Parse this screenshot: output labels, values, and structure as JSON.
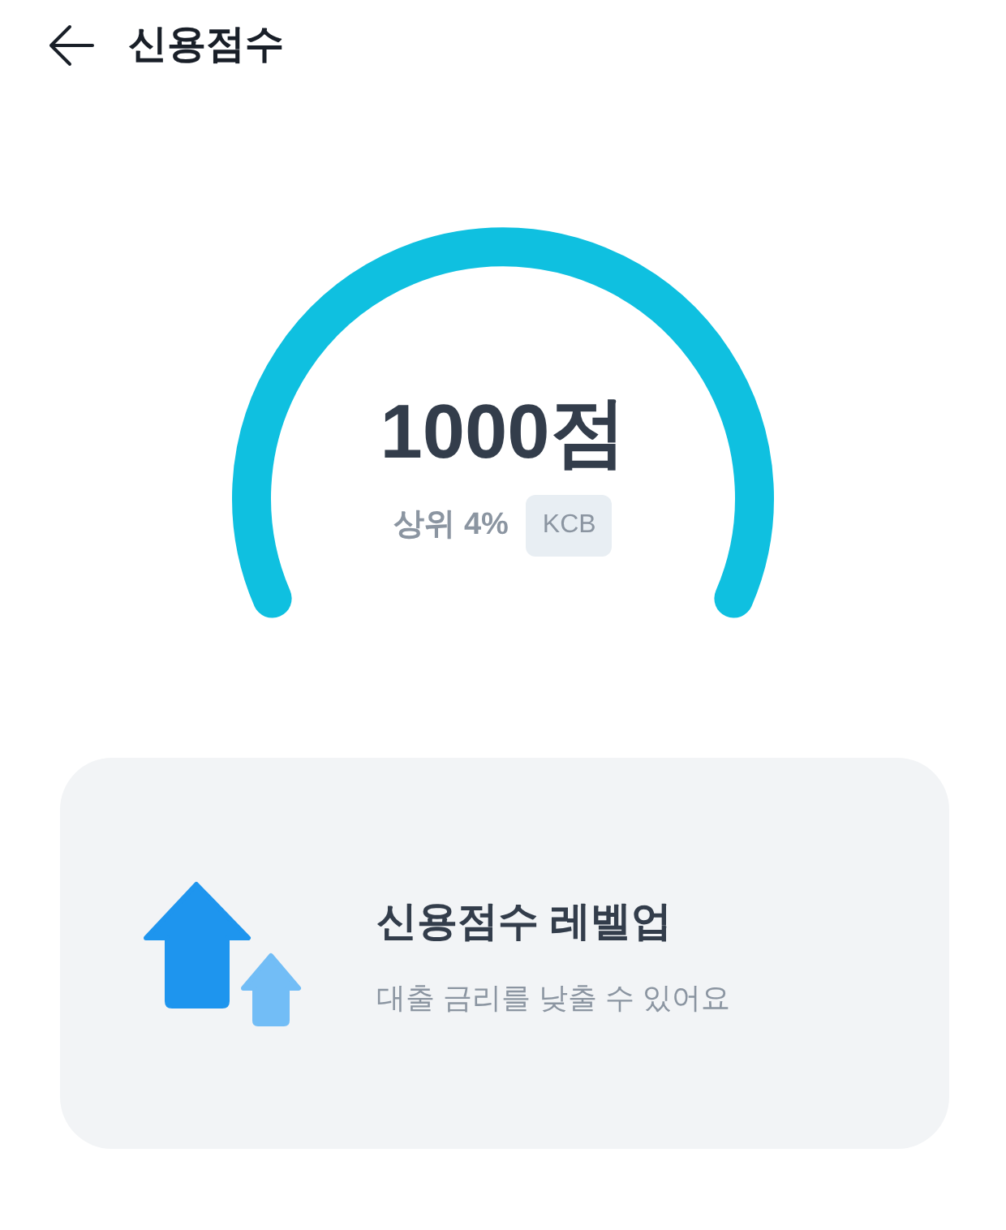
{
  "header": {
    "title": "신용점수"
  },
  "score": {
    "value": "1000점",
    "rank": "상위 4%",
    "bureau": "KCB"
  },
  "card": {
    "title": "신용점수 레벨업",
    "subtitle": "대출 금리를 낮출 수 있어요"
  }
}
